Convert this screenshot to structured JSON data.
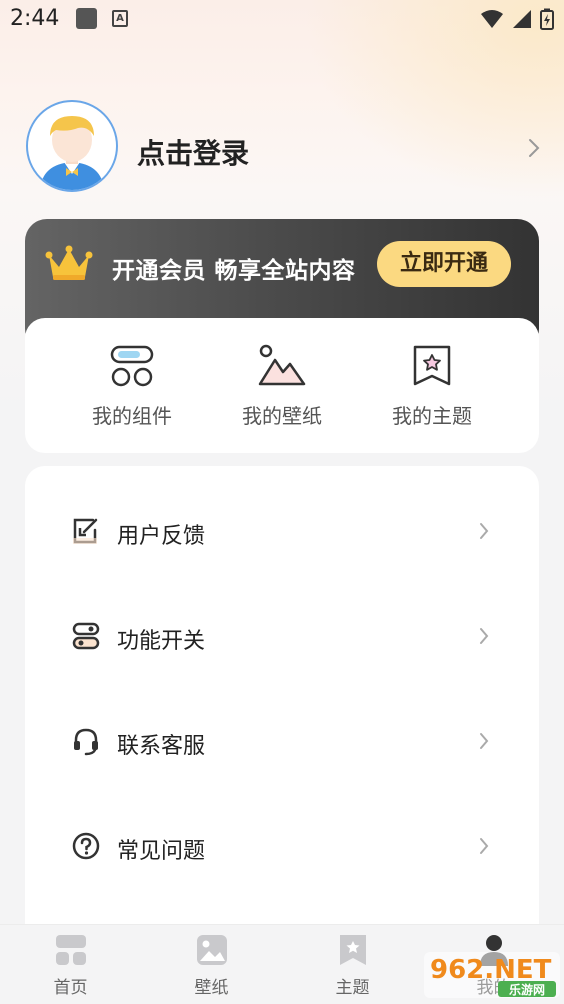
{
  "status_bar": {
    "time": "2:44"
  },
  "profile": {
    "login_label": "点击登录"
  },
  "vip": {
    "text": "开通会员 畅享全站内容",
    "button_label": "立即开通"
  },
  "shortcuts": [
    {
      "label": "我的组件",
      "icon": "widgets-icon"
    },
    {
      "label": "我的壁纸",
      "icon": "wallpaper-icon"
    },
    {
      "label": "我的主题",
      "icon": "theme-icon"
    }
  ],
  "menu": [
    {
      "label": "用户反馈",
      "icon": "feedback-icon"
    },
    {
      "label": "功能开关",
      "icon": "toggle-icon"
    },
    {
      "label": "联系客服",
      "icon": "headset-icon"
    },
    {
      "label": "常见问题",
      "icon": "question-icon"
    }
  ],
  "bottom_nav": [
    {
      "label": "首页",
      "icon": "home-icon"
    },
    {
      "label": "壁纸",
      "icon": "wallpaper-icon"
    },
    {
      "label": "主题",
      "icon": "theme-icon"
    },
    {
      "label": "我的",
      "icon": "profile-icon",
      "active": true
    }
  ],
  "watermark": {
    "text": "962.NET",
    "subtext": "乐游网"
  },
  "colors": {
    "accent": "#fbd981",
    "vip_bg": "#4a4a4a",
    "avatar_ring": "#6aa6e8"
  }
}
